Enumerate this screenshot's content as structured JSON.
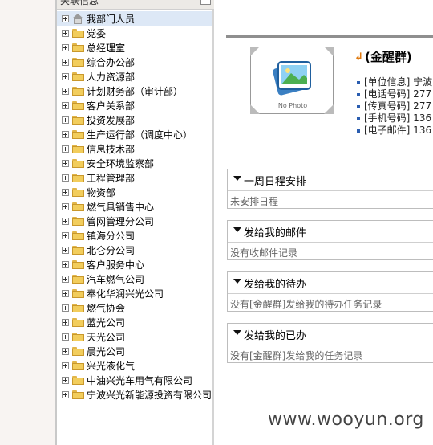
{
  "panel": {
    "title": "关联信息",
    "collapse_glyph": "−"
  },
  "tree": {
    "items": [
      {
        "label": "我部门人员",
        "icon": "home-icon"
      },
      {
        "label": "党委",
        "icon": "folder-icon"
      },
      {
        "label": "总经理室",
        "icon": "folder-icon"
      },
      {
        "label": "综合办公部",
        "icon": "folder-icon"
      },
      {
        "label": "人力资源部",
        "icon": "folder-icon"
      },
      {
        "label": "计划财务部（审计部）",
        "icon": "folder-icon"
      },
      {
        "label": "客户关系部",
        "icon": "folder-icon"
      },
      {
        "label": "投资发展部",
        "icon": "folder-icon"
      },
      {
        "label": "生产运行部（调度中心）",
        "icon": "folder-icon"
      },
      {
        "label": "信息技术部",
        "icon": "folder-icon"
      },
      {
        "label": "安全环境监察部",
        "icon": "folder-icon"
      },
      {
        "label": "工程管理部",
        "icon": "folder-icon"
      },
      {
        "label": "物资部",
        "icon": "folder-icon"
      },
      {
        "label": "燃气具销售中心",
        "icon": "folder-icon"
      },
      {
        "label": "管网管理分公司",
        "icon": "folder-icon"
      },
      {
        "label": "镇海分公司",
        "icon": "folder-icon"
      },
      {
        "label": "北仑分公司",
        "icon": "folder-icon"
      },
      {
        "label": "客户服务中心",
        "icon": "folder-icon"
      },
      {
        "label": "汽车燃气公司",
        "icon": "folder-icon"
      },
      {
        "label": "奉化华润兴光公司",
        "icon": "folder-icon"
      },
      {
        "label": "燃气协会",
        "icon": "folder-icon"
      },
      {
        "label": "蓝光公司",
        "icon": "folder-icon"
      },
      {
        "label": "天光公司",
        "icon": "folder-icon"
      },
      {
        "label": "晨光公司",
        "icon": "folder-icon"
      },
      {
        "label": "兴光液化气",
        "icon": "folder-icon"
      },
      {
        "label": "中油兴光车用气有限公司",
        "icon": "folder-icon"
      },
      {
        "label": "宁波兴光新能源投资有限公司",
        "icon": "folder-icon"
      }
    ]
  },
  "profile": {
    "photo_caption": "No Photo",
    "name": "(金醒群)",
    "info": [
      "[单位信息] 宁波",
      "[电话号码] 277",
      "[传真号码] 277",
      "[手机号码] 136",
      "[电子邮件] 136"
    ]
  },
  "sections": [
    {
      "title": "一周日程安排",
      "body": "未安排日程"
    },
    {
      "title": "发给我的邮件",
      "body": "没有收邮件记录"
    },
    {
      "title": "发给我的待办",
      "body": "没有[金醒群]发给我的待办任务记录"
    },
    {
      "title": "发给我的已办",
      "body": "没有[金醒群]发给我的任务记录"
    }
  ],
  "watermark": "www.wooyun.org",
  "colors": {
    "accent_arrow": "#e07a10",
    "bullet": "#2a5db0",
    "selected_row": "#dde8f6"
  }
}
